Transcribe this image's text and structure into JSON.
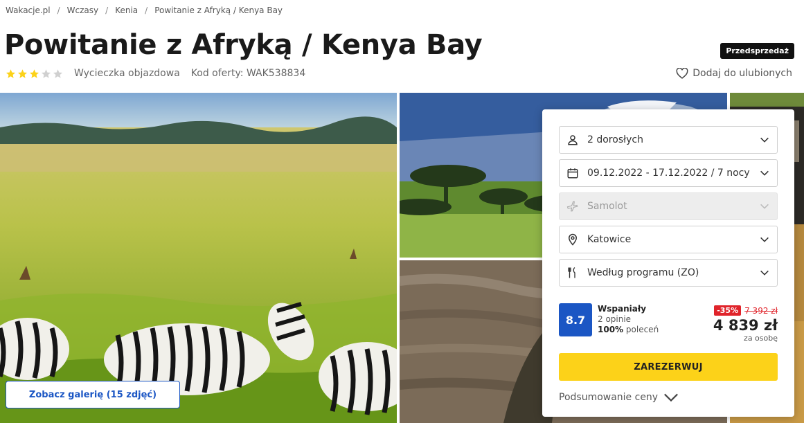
{
  "breadcrumb": [
    "Wakacje.pl",
    "Wczasy",
    "Kenia",
    "Powitanie z Afryką / Kenya Bay"
  ],
  "title": "Powitanie z Afryką / Kenya Bay",
  "badge": "Przedsprzedaż",
  "stars": {
    "rating": 3,
    "max": 5,
    "color": "#fcd219",
    "empty_color": "#d0d0d0"
  },
  "trip_type": "Wycieczka objazdowa",
  "offer_code": "Kod oferty: WAK538834",
  "favorite_label": "Dodaj do ulubionych",
  "gallery": {
    "button_label": "Zobacz galerię (15 zdjęć)",
    "images": [
      "zebras-savanna",
      "kilimanjaro-acacia",
      "crocodile-river",
      "safari-vehicle"
    ]
  },
  "booking": {
    "fields": [
      {
        "icon": "person-icon",
        "label": "2 dorosłych",
        "disabled": false
      },
      {
        "icon": "calendar-icon",
        "label": "09.12.2022 - 17.12.2022 / 7 nocy",
        "disabled": false
      },
      {
        "icon": "plane-icon",
        "label": "Samolot",
        "disabled": true
      },
      {
        "icon": "location-pin-icon",
        "label": "Katowice",
        "disabled": false
      },
      {
        "icon": "cutlery-icon",
        "label": "Według programu (ZO)",
        "disabled": false
      }
    ],
    "rating": {
      "score": "8.7",
      "word": "Wspaniały",
      "reviews": "2 opinie",
      "recommend_pct": "100%",
      "recommend_text": "poleceń"
    },
    "price": {
      "discount": "-35%",
      "old": "7 392 zł",
      "current": "4 839 zł",
      "per": "za osobę"
    },
    "book_label": "ZAREZERWUJ",
    "summary_label": "Podsumowanie ceny"
  },
  "colors": {
    "accent": "#1b56c4",
    "book": "#fcd219",
    "sale": "#e0242b"
  }
}
